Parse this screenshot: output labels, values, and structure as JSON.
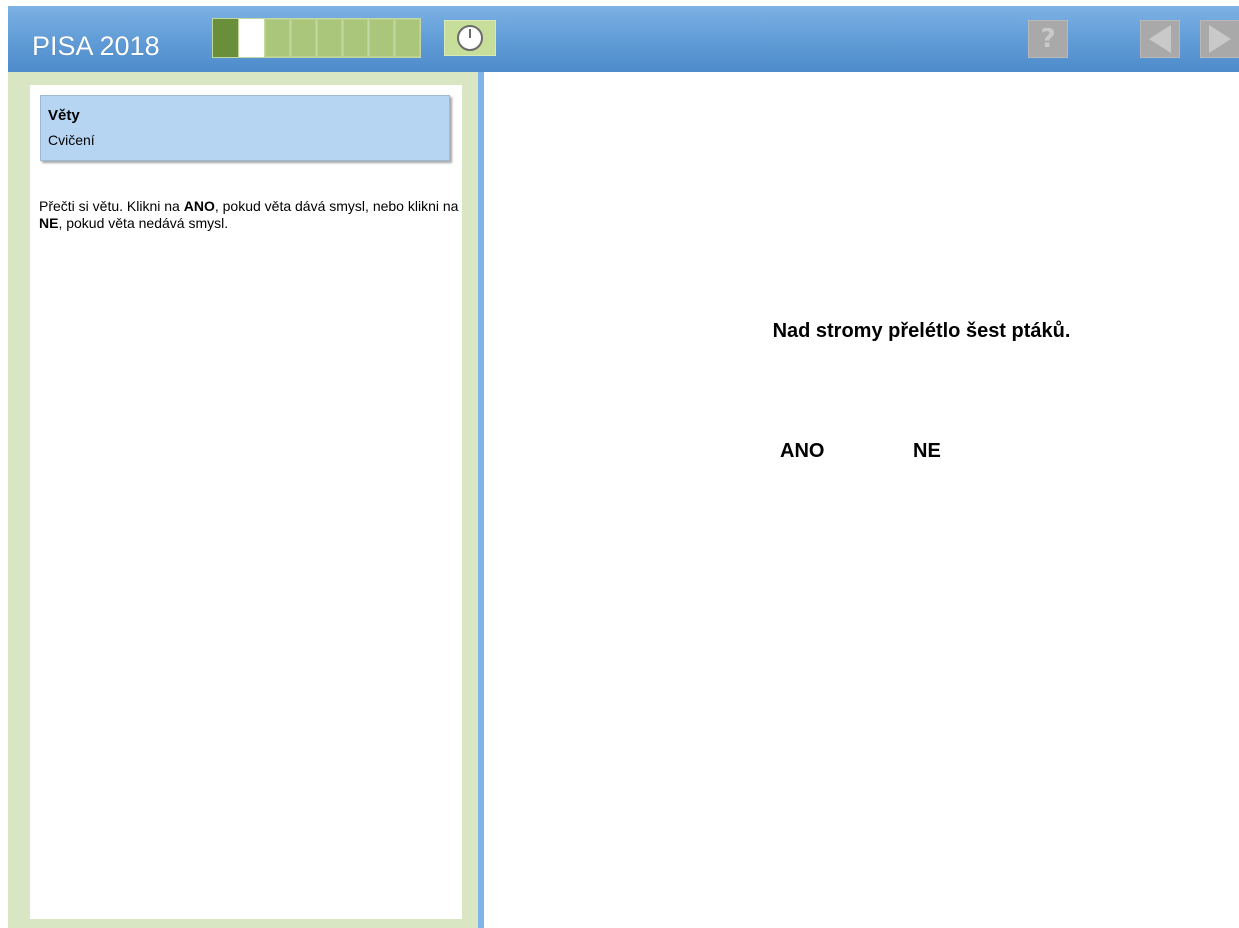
{
  "header": {
    "title": "PISA 2018",
    "progress": {
      "total_segments": 8,
      "completed_segments": 1,
      "current_segment": 2
    },
    "timer_icon": "clock-icon",
    "help_icon": "help-icon",
    "help_glyph": "?",
    "prev_icon": "arrow-left-icon",
    "next_icon": "arrow-right-icon"
  },
  "sidebar": {
    "unit_title": "Věty",
    "unit_subtitle": "Cvičení",
    "instructions": {
      "part1": "Přečti si větu. Klikni na ",
      "bold1": "ANO",
      "part2": ", pokud věta dává smysl, nebo klikni na ",
      "bold2": "NE",
      "part3": ", pokud věta nedává smysl."
    }
  },
  "main": {
    "sentence": "Nad stromy přelétlo šest ptáků.",
    "answers": {
      "yes": "ANO",
      "no": "NE"
    }
  },
  "colors": {
    "header_blue": "#5f9bd6",
    "progress_done": "#6a8f3a",
    "progress_pending": "#a9c67b",
    "sidebar_frame": "#d8e6c4",
    "unit_card": "#b5d5f3",
    "disabled_button": "#a9a9a9"
  }
}
